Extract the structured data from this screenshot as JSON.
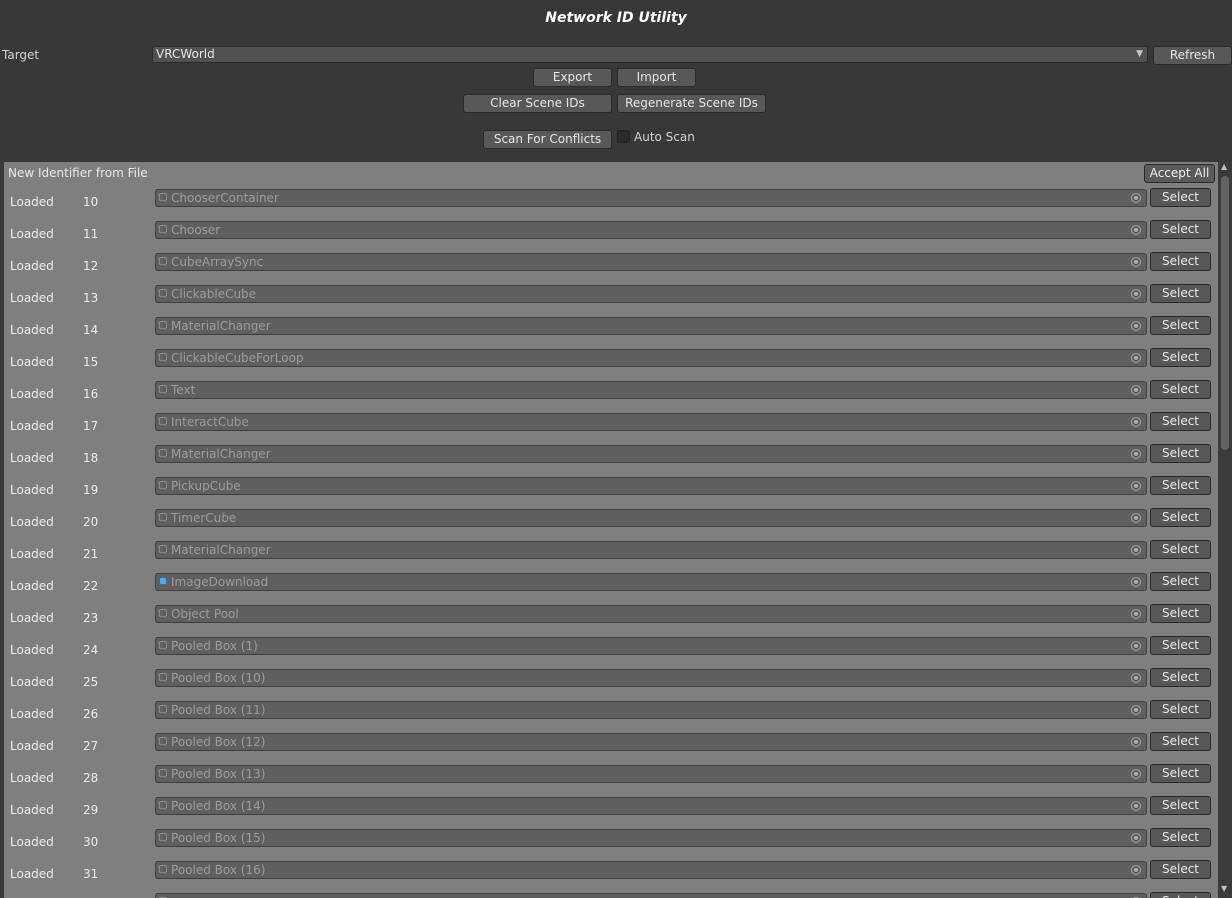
{
  "window": {
    "title": "Network ID Utility"
  },
  "target": {
    "label": "Target",
    "value": "VRCWorld",
    "refresh_label": "Refresh"
  },
  "actions": {
    "export_label": "Export",
    "import_label": "Import",
    "clear_label": "Clear Scene IDs",
    "regenerate_label": "Regenerate Scene IDs",
    "scan_label": "Scan For Conflicts",
    "auto_scan_label": "Auto Scan",
    "auto_scan_checked": false
  },
  "list": {
    "header": "New Identifier from File",
    "accept_all_label": "Accept All",
    "select_label": "Select",
    "rows": [
      {
        "status": "Loaded",
        "id": "10",
        "object": "ChooserContainer",
        "icon": "gameobject-icon"
      },
      {
        "status": "Loaded",
        "id": "11",
        "object": "Chooser",
        "icon": "gameobject-icon"
      },
      {
        "status": "Loaded",
        "id": "12",
        "object": "CubeArraySync",
        "icon": "gameobject-icon"
      },
      {
        "status": "Loaded",
        "id": "13",
        "object": "ClickableCube",
        "icon": "gameobject-icon"
      },
      {
        "status": "Loaded",
        "id": "14",
        "object": "MaterialChanger",
        "icon": "gameobject-icon"
      },
      {
        "status": "Loaded",
        "id": "15",
        "object": "ClickableCubeForLoop",
        "icon": "gameobject-icon"
      },
      {
        "status": "Loaded",
        "id": "16",
        "object": "Text",
        "icon": "gameobject-icon"
      },
      {
        "status": "Loaded",
        "id": "17",
        "object": "InteractCube",
        "icon": "gameobject-icon"
      },
      {
        "status": "Loaded",
        "id": "18",
        "object": "MaterialChanger",
        "icon": "gameobject-icon"
      },
      {
        "status": "Loaded",
        "id": "19",
        "object": "PickupCube",
        "icon": "gameobject-icon"
      },
      {
        "status": "Loaded",
        "id": "20",
        "object": "TimerCube",
        "icon": "gameobject-icon"
      },
      {
        "status": "Loaded",
        "id": "21",
        "object": "MaterialChanger",
        "icon": "gameobject-icon"
      },
      {
        "status": "Loaded",
        "id": "22",
        "object": "ImageDownload",
        "icon": "prefab-icon"
      },
      {
        "status": "Loaded",
        "id": "23",
        "object": "Object Pool",
        "icon": "gameobject-icon"
      },
      {
        "status": "Loaded",
        "id": "24",
        "object": "Pooled Box (1)",
        "icon": "gameobject-icon"
      },
      {
        "status": "Loaded",
        "id": "25",
        "object": "Pooled Box (10)",
        "icon": "gameobject-icon"
      },
      {
        "status": "Loaded",
        "id": "26",
        "object": "Pooled Box (11)",
        "icon": "gameobject-icon"
      },
      {
        "status": "Loaded",
        "id": "27",
        "object": "Pooled Box (12)",
        "icon": "gameobject-icon"
      },
      {
        "status": "Loaded",
        "id": "28",
        "object": "Pooled Box (13)",
        "icon": "gameobject-icon"
      },
      {
        "status": "Loaded",
        "id": "29",
        "object": "Pooled Box (14)",
        "icon": "gameobject-icon"
      },
      {
        "status": "Loaded",
        "id": "30",
        "object": "Pooled Box (15)",
        "icon": "gameobject-icon"
      },
      {
        "status": "Loaded",
        "id": "31",
        "object": "Pooled Box (16)",
        "icon": "gameobject-icon"
      },
      {
        "status": "",
        "id": "",
        "object": "",
        "icon": "gameobject-icon"
      }
    ]
  }
}
